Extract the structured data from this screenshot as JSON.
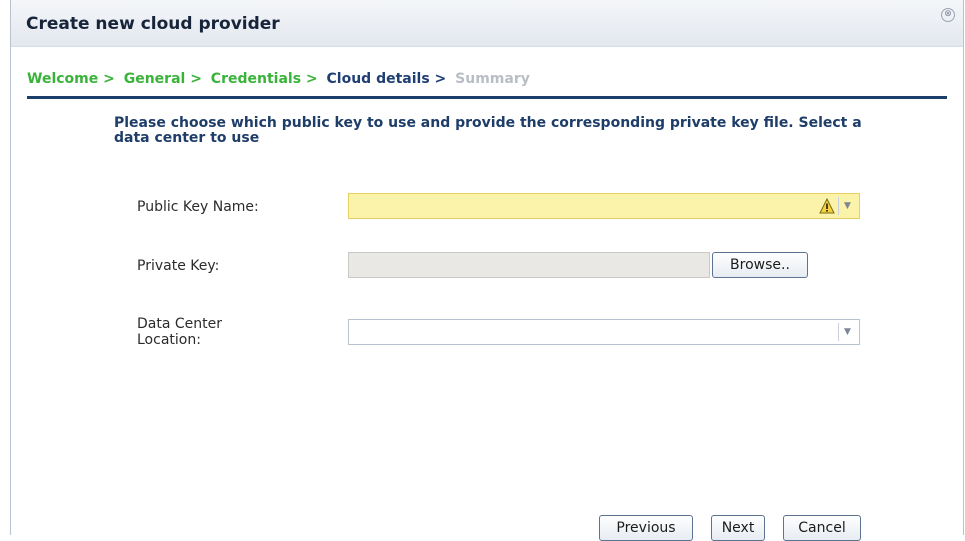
{
  "dialog": {
    "title": "Create new cloud provider",
    "close_glyph": "⊗"
  },
  "breadcrumb": {
    "steps": [
      {
        "label": "Welcome >",
        "state": "done"
      },
      {
        "label": "General >",
        "state": "done"
      },
      {
        "label": "Credentials >",
        "state": "done"
      },
      {
        "label": "Cloud details >",
        "state": "current"
      },
      {
        "label": "Summary",
        "state": "future"
      }
    ]
  },
  "instructions": "Please choose which public key to use and provide the corresponding private key file. Select a data center to use",
  "form": {
    "public_key": {
      "label": "Public Key Name:",
      "value": "",
      "status": "warning",
      "icon": "warning-icon"
    },
    "private_key": {
      "label": "Private Key:",
      "value": "",
      "browse_label": "Browse.."
    },
    "data_center": {
      "label_line1": "Data Center",
      "label_line2": "Location:",
      "value": ""
    }
  },
  "footer": {
    "previous_label": "Previous",
    "next_label": "Next",
    "cancel_label": "Cancel"
  },
  "colors": {
    "done_step": "#39b339",
    "current_step": "#1f3f73",
    "future_step": "#b9bec5",
    "warning_field_bg": "#fbf3a9",
    "rule": "#1c3e6a"
  }
}
